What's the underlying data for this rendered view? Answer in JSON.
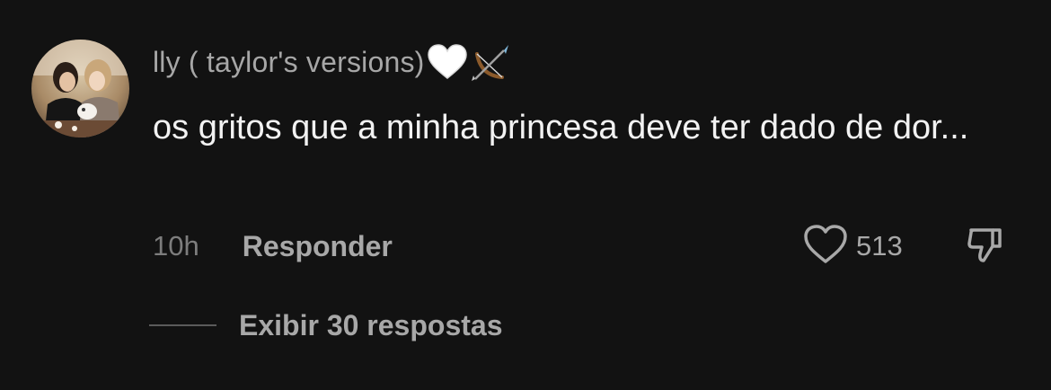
{
  "comment": {
    "username": "lly ( taylor's versions)",
    "username_emojis": [
      "white-heart-icon",
      "bow-and-arrow-icon"
    ],
    "text": "os gritos que a minha princesa deve ter dado de dor...",
    "timestamp": "10h",
    "reply_label": "Responder",
    "like_count": "513",
    "view_replies_label": "Exibir 30 respostas"
  },
  "colors": {
    "background": "#121212",
    "username": "#a7a7a7",
    "text": "#f2f2f2",
    "secondary": "#a8a8a8",
    "timestamp": "#7d7d7d"
  }
}
